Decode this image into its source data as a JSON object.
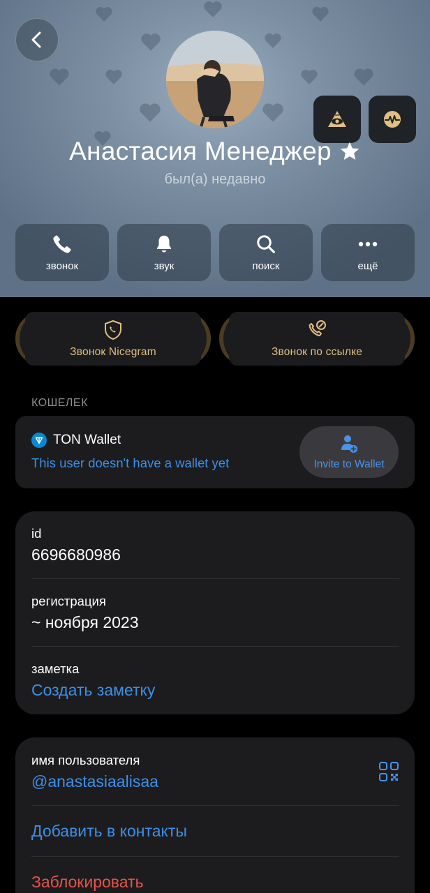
{
  "profile": {
    "name": "Анастасия Менеджер",
    "status": "был(а) недавно",
    "badge_icon": "star-icon"
  },
  "header": {
    "back_icon": "chevron-left-icon",
    "top_buttons": [
      {
        "icon": "eye-pyramid-icon"
      },
      {
        "icon": "waveform-badge-icon"
      }
    ]
  },
  "actions": [
    {
      "label": "звонок",
      "icon": "phone-icon"
    },
    {
      "label": "звук",
      "icon": "bell-icon"
    },
    {
      "label": "поиск",
      "icon": "search-icon"
    },
    {
      "label": "ещё",
      "icon": "more-dots-icon"
    }
  ],
  "nicegram": [
    {
      "label": "Звонок Nicegram",
      "icon": "shield-phone-icon"
    },
    {
      "label": "Звонок по ссылке",
      "icon": "phone-link-icon"
    }
  ],
  "wallet": {
    "section_title": "КОШЕЛЕК",
    "title": "TON Wallet",
    "subtitle": "This user doesn't have a wallet yet",
    "invite_label": "Invite to Wallet"
  },
  "info": {
    "id_label": "id",
    "id_value": "6696680986",
    "reg_label": "регистрация",
    "reg_value": "~ ноября 2023",
    "note_label": "заметка",
    "note_link": "Создать заметку"
  },
  "user": {
    "username_label": "имя пользователя",
    "username_value": "@anastasiaalisaa",
    "add_contact": "Добавить в контакты",
    "block": "Заблокировать"
  },
  "colors": {
    "accent_blue": "#3e8fe8",
    "gold": "#e0bf84",
    "danger": "#e5534b",
    "card_bg": "#1c1c1e"
  }
}
